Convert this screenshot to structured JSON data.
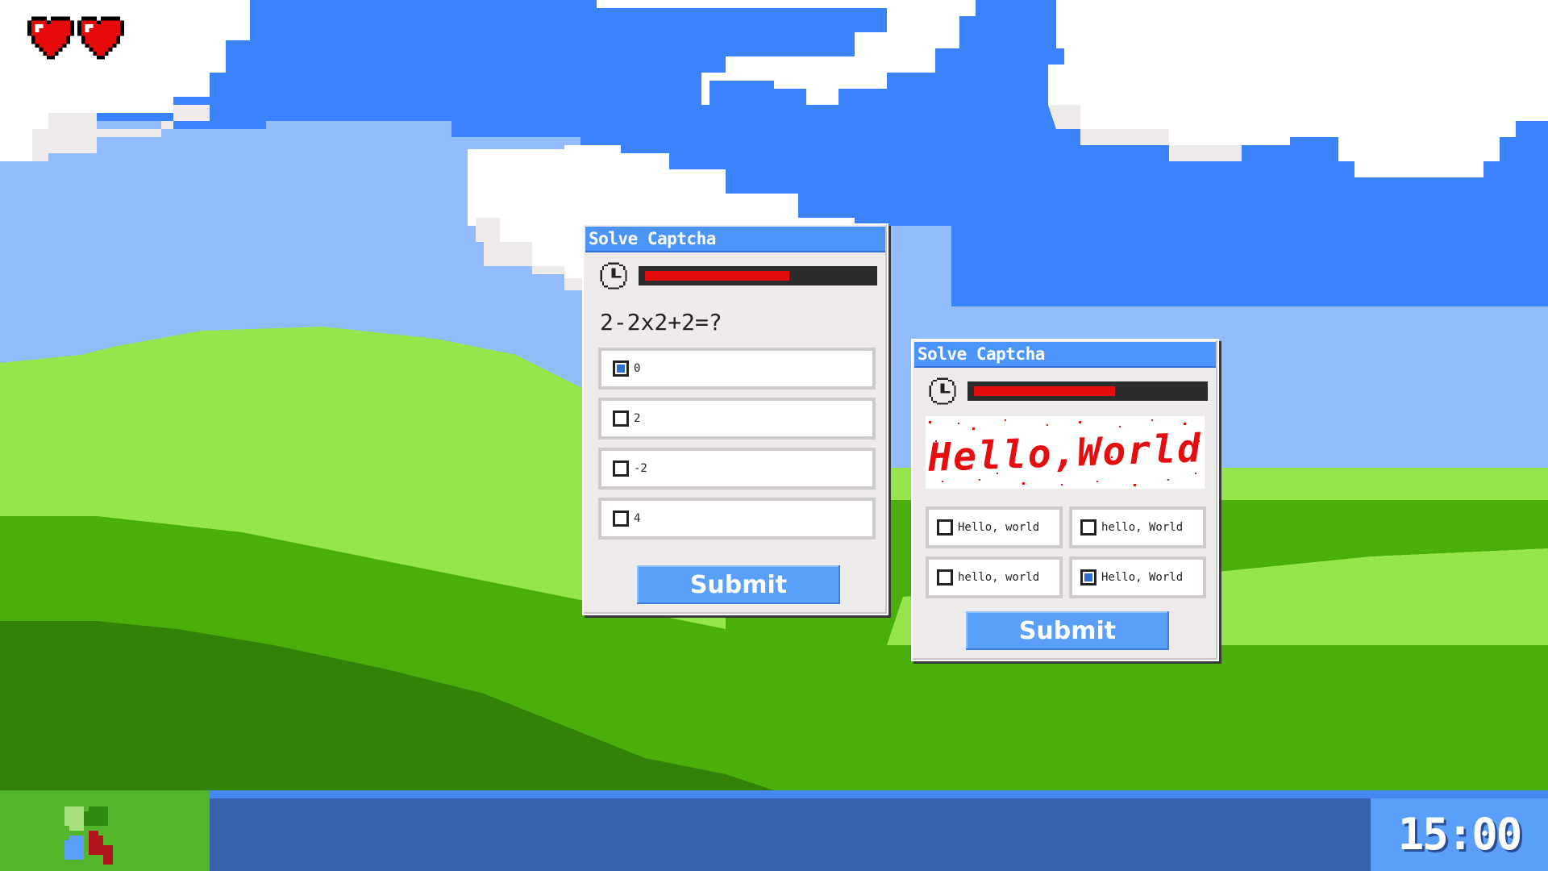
{
  "player": {
    "lives": 2,
    "heart_color": "#e50b0b"
  },
  "windows": [
    {
      "title": "Solve Captcha",
      "timer_remaining": 0.64,
      "question": "2-2x2+2=?",
      "options": [
        {
          "label": "0",
          "checked": true
        },
        {
          "label": "2",
          "checked": false
        },
        {
          "label": "-2",
          "checked": false
        },
        {
          "label": "4",
          "checked": false
        }
      ],
      "submit_label": "Submit"
    },
    {
      "title": "Solve Captcha",
      "timer_remaining": 0.62,
      "captcha_text": "Hello,World",
      "options": [
        {
          "label": "Hello, world",
          "checked": false
        },
        {
          "label": "hello, World",
          "checked": false
        },
        {
          "label": "hello, world",
          "checked": false
        },
        {
          "label": "Hello, World",
          "checked": true
        }
      ],
      "submit_label": "Submit"
    }
  ],
  "taskbar": {
    "clock": "15:00"
  },
  "colors": {
    "sky": "#3b83fd",
    "sky_light": "#93bcfc",
    "cloud": "#efebea",
    "grass_light": "#96e54c",
    "grass": "#4aaf0b",
    "grass_dark": "#348107",
    "accent_blue": "#5aa0fb",
    "taskbar": "#3760ad"
  }
}
